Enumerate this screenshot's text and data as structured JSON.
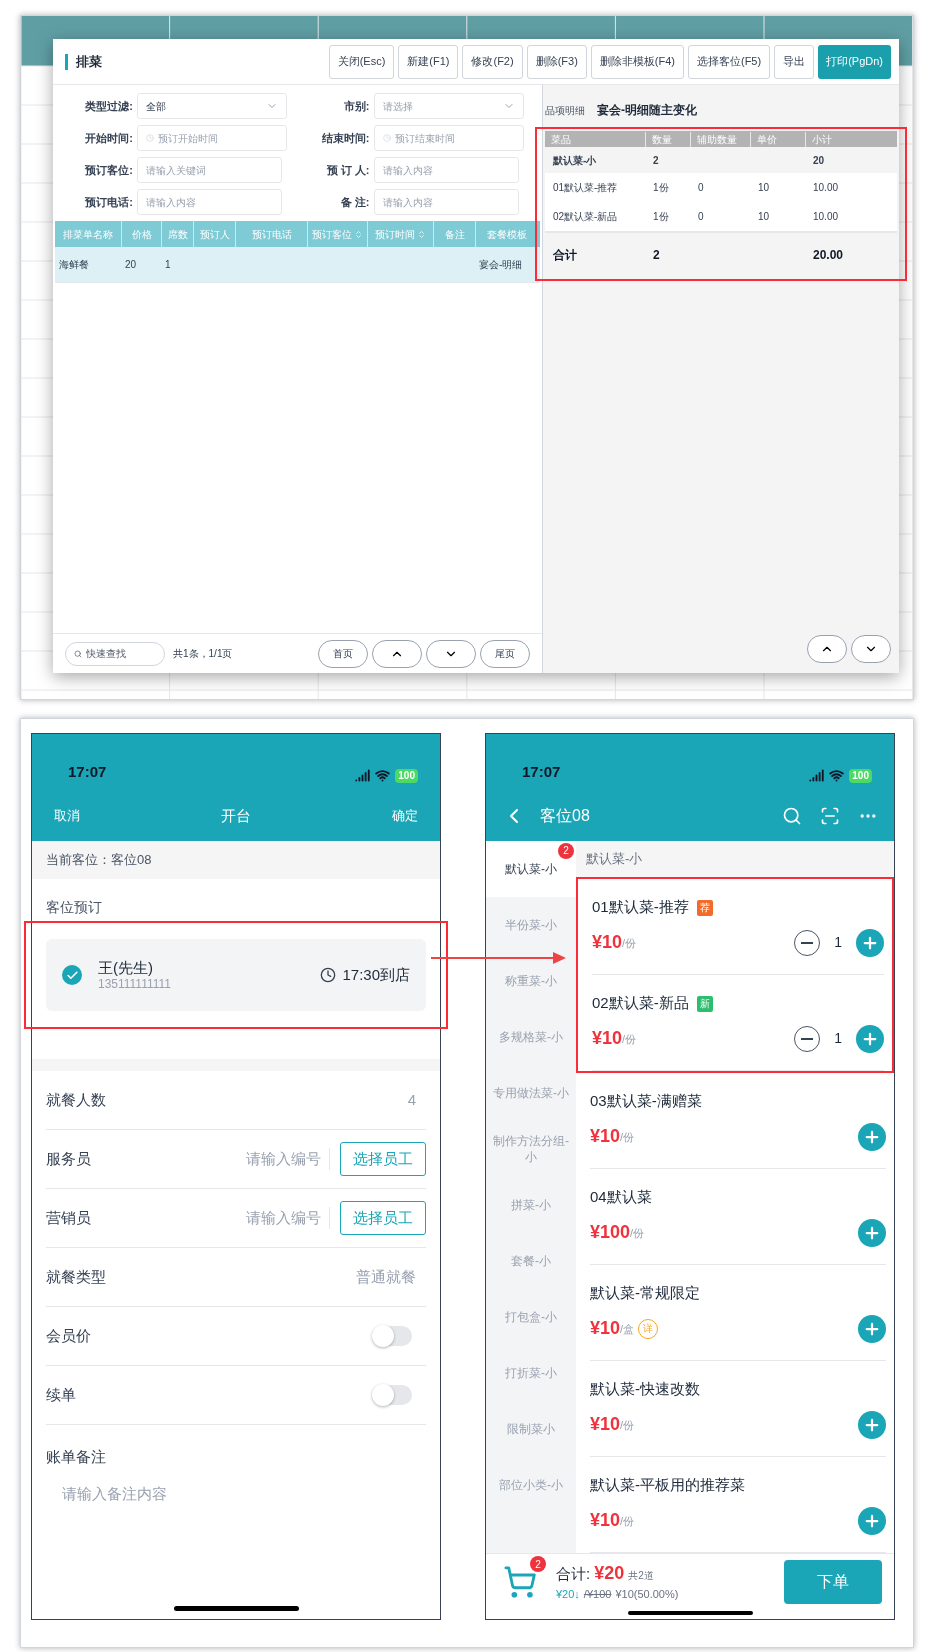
{
  "desktop": {
    "title": "排菜",
    "toolbar": [
      {
        "label": "关闭(Esc)",
        "primary": false
      },
      {
        "label": "新建(F1)",
        "primary": false
      },
      {
        "label": "修改(F2)",
        "primary": false
      },
      {
        "label": "删除(F3)",
        "primary": false
      },
      {
        "label": "删除非模板(F4)",
        "primary": false
      },
      {
        "label": "选择客位(F5)",
        "primary": false
      },
      {
        "label": "导出",
        "primary": false
      },
      {
        "label": "打印(PgDn)",
        "primary": true
      }
    ],
    "filters": [
      {
        "label": "类型过滤:",
        "kind": "select",
        "value": "全部"
      },
      {
        "label": "市别:",
        "kind": "select",
        "placeholder": "请选择"
      },
      {
        "label": "开始时间:",
        "kind": "time",
        "placeholder": "预订开始时间"
      },
      {
        "label": "结束时间:",
        "kind": "time",
        "placeholder": "预订结束时间"
      },
      {
        "label": "预订客位:",
        "kind": "text",
        "placeholder": "请输入关键词"
      },
      {
        "label": "预 订 人:",
        "kind": "text",
        "placeholder": "请输入内容"
      },
      {
        "label": "预订电话:",
        "kind": "text",
        "placeholder": "请输入内容"
      },
      {
        "label": "备 注:",
        "kind": "text",
        "placeholder": "请输入内容"
      }
    ],
    "table": {
      "columns": [
        {
          "label": "排菜单名称",
          "sortable": false
        },
        {
          "label": "价格",
          "sortable": false
        },
        {
          "label": "席数",
          "sortable": false
        },
        {
          "label": "预订人",
          "sortable": false
        },
        {
          "label": "预订电话",
          "sortable": false
        },
        {
          "label": "预订客位",
          "sortable": true
        },
        {
          "label": "预订时间",
          "sortable": true
        },
        {
          "label": "备注",
          "sortable": false
        },
        {
          "label": "套餐模板",
          "sortable": false
        }
      ],
      "rows": [
        {
          "selected": true,
          "cells": [
            "海鲜餐",
            "20",
            "1",
            "",
            "",
            "",
            "",
            "",
            "宴会-明细"
          ]
        }
      ]
    },
    "footer": {
      "search_placeholder": "快速查找",
      "count": "共1条，1/1页",
      "first": "首页",
      "last": "尾页"
    },
    "detail": {
      "label": "品项明细",
      "title": "宴会-明细随主变化",
      "columns": [
        "菜品",
        "数量",
        "辅助数量",
        "单价",
        "小计"
      ],
      "rows": [
        {
          "kind": "group",
          "cells": [
            "默认菜-小",
            "2",
            null,
            null,
            "20"
          ]
        },
        {
          "kind": "item",
          "cells": [
            "01默认菜-推荐",
            "1份",
            "0",
            "10",
            "10.00"
          ]
        },
        {
          "kind": "item",
          "cells": [
            "02默认菜-新品",
            "1份",
            "0",
            "10",
            "10.00"
          ]
        },
        {
          "kind": "total",
          "cells": [
            "合计",
            "2",
            null,
            null,
            "20.00"
          ]
        }
      ]
    }
  },
  "open_table": {
    "time": "17:07",
    "battery": "100",
    "cancel": "取消",
    "title": "开台",
    "confirm": "确定",
    "current": "当前客位：客位08",
    "section": "客位预订",
    "reservation": {
      "name": "王(先生)",
      "phone": "135111111111",
      "arrival": "17:30到店",
      "checked": true
    },
    "rows": [
      {
        "kind": "value",
        "label": "就餐人数",
        "value": "4"
      },
      {
        "kind": "staff",
        "label": "服务员",
        "placeholder": "请输入编号",
        "button": "选择员工"
      },
      {
        "kind": "staff",
        "label": "营销员",
        "placeholder": "请输入编号",
        "button": "选择员工"
      },
      {
        "kind": "value",
        "label": "就餐类型",
        "value": "普通就餐"
      },
      {
        "kind": "toggle",
        "label": "会员价",
        "on": false
      },
      {
        "kind": "toggle",
        "label": "续单",
        "on": false
      }
    ],
    "note": {
      "label": "账单备注",
      "placeholder": "请输入备注内容"
    }
  },
  "order": {
    "time": "17:07",
    "battery": "100",
    "title": "客位08",
    "categories": [
      {
        "label": "默认菜-小",
        "selected": true,
        "badge": "2"
      },
      {
        "label": "半份菜-小",
        "selected": false
      },
      {
        "label": "称重菜-小",
        "selected": false
      },
      {
        "label": "多规格菜-小",
        "selected": false
      },
      {
        "label": "专用做法菜-小",
        "selected": false
      },
      {
        "label": "制作方法分组-小",
        "selected": false
      },
      {
        "label": "拼菜-小",
        "selected": false
      },
      {
        "label": "套餐-小",
        "selected": false
      },
      {
        "label": "打包盒-小",
        "selected": false
      },
      {
        "label": "打折菜-小",
        "selected": false
      },
      {
        "label": "限制菜小",
        "selected": false
      },
      {
        "label": "部位小类-小",
        "selected": false
      }
    ],
    "section": "默认菜-小",
    "dishes": [
      {
        "name": "01默认菜-推荐",
        "tag": {
          "text": "荐",
          "kind": "filled",
          "color": "#f26b2a"
        },
        "price": "¥10",
        "unit": "/份",
        "qty": "1",
        "highlighted": true
      },
      {
        "name": "02默认菜-新品",
        "tag": {
          "text": "新",
          "kind": "filled",
          "color": "#2dbd6e"
        },
        "price": "¥10",
        "unit": "/份",
        "qty": "1",
        "highlighted": true
      },
      {
        "name": "03默认菜-满赠菜",
        "price": "¥10",
        "unit": "/份",
        "highlighted": false
      },
      {
        "name": "04默认菜",
        "price": "¥100",
        "unit": "/份",
        "highlighted": false
      },
      {
        "name": "默认菜-常规限定",
        "price": "¥10",
        "unit": "/盒",
        "detail": "详",
        "highlighted": false
      },
      {
        "name": "默认菜-快速改数",
        "price": "¥10",
        "unit": "/份",
        "highlighted": false
      },
      {
        "name": "默认菜-平板用的推荐菜",
        "price": "¥10",
        "unit": "/份",
        "highlighted": false
      }
    ],
    "cart": {
      "badge": "2",
      "total_label": "合计:",
      "total": "¥20",
      "count": "共2道",
      "discounted": "¥20↓",
      "original": "/¥100",
      "saving": "¥10(50.00%)",
      "submit": "下单"
    }
  }
}
